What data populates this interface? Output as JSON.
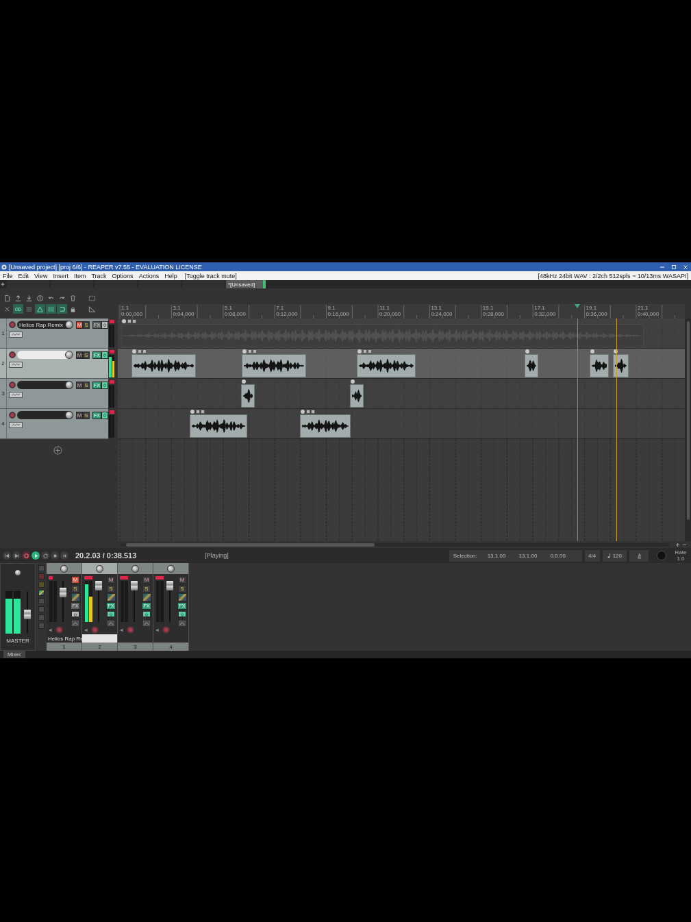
{
  "window": {
    "title": "[Unsaved project] [proj 6/6] - REAPER v7.55 - EVALUATION LICENSE"
  },
  "menu": {
    "items": [
      "File",
      "Edit",
      "View",
      "Insert",
      "Item",
      "Track",
      "Options",
      "Actions",
      "Help"
    ],
    "last_action": "[Toggle track mute]",
    "audio_status": "[48kHz 24bit WAV : 2/2ch 512spls ~ 10/13ms WASAPI]"
  },
  "project_tabs": [
    {
      "selected": false
    },
    {
      "selected": false
    },
    {
      "selected": false
    },
    {
      "selected": false
    },
    {
      "selected": false
    },
    {
      "label": "*[Unsaved]",
      "selected": true
    }
  ],
  "toolbar": {
    "rows": [
      [
        {
          "kind": "new",
          "on": false
        },
        {
          "kind": "import",
          "on": false
        },
        {
          "kind": "save",
          "on": false
        },
        {
          "kind": "count",
          "on": false
        },
        {
          "kind": "undo",
          "on": false
        },
        {
          "kind": "redo",
          "on": false
        },
        {
          "kind": "theme",
          "on": false
        },
        {
          "kind": "dock",
          "on": false
        }
      ],
      [
        {
          "kind": "cut",
          "on": false
        },
        {
          "kind": "link",
          "on": true
        },
        {
          "kind": "grid",
          "on": false
        },
        {
          "kind": "snap",
          "on": true
        },
        {
          "kind": "lines",
          "on": true
        },
        {
          "kind": "loop",
          "on": true
        },
        {
          "kind": "lock",
          "on": false
        },
        {
          "kind": "ruler",
          "on": false
        }
      ]
    ]
  },
  "ruler": {
    "marks": [
      {
        "bar": "1.1",
        "time": "0:00.000"
      },
      {
        "bar": "3.1",
        "time": "0:04.000"
      },
      {
        "bar": "5.1",
        "time": "0:08.000"
      },
      {
        "bar": "7.1",
        "time": "0:12.000"
      },
      {
        "bar": "9.1",
        "time": "0:16.000"
      },
      {
        "bar": "11.1",
        "time": "0:20.000"
      },
      {
        "bar": "13.1",
        "time": "0:24.000"
      },
      {
        "bar": "15.1",
        "time": "0:28.000"
      },
      {
        "bar": "17.1",
        "time": "0:32.000"
      },
      {
        "bar": "19.1",
        "time": "0:36.000"
      },
      {
        "bar": "21.1",
        "time": "0:40.000"
      }
    ]
  },
  "tracks": [
    {
      "number": "1",
      "name": "Helios Rap Remix",
      "selected": false,
      "muted": true,
      "fx_active": false,
      "clipped": true,
      "mute_label": "M",
      "solo_label": "S",
      "fx_label": "FX"
    },
    {
      "number": "2",
      "selected": true,
      "muted": false,
      "fx_active": true,
      "clipped": true,
      "meter": [
        {
          "level": 0.9
        },
        {
          "level": 0.72
        }
      ],
      "mute_label": "M",
      "solo_label": "S",
      "fx_label": "FX"
    },
    {
      "number": "3",
      "selected": false,
      "muted": false,
      "fx_active": true,
      "clipped": true,
      "mute_label": "M",
      "solo_label": "S",
      "fx_label": "FX"
    },
    {
      "number": "4",
      "selected": false,
      "muted": false,
      "fx_active": true,
      "clipped": true,
      "mute_label": "M",
      "solo_label": "S",
      "fx_label": "FX"
    }
  ],
  "transport": {
    "buttons": [
      {
        "kind": "start",
        "on": false
      },
      {
        "kind": "end",
        "on": false
      },
      {
        "kind": "record",
        "on": false
      },
      {
        "kind": "play",
        "on": true
      },
      {
        "kind": "repeat",
        "on": false
      },
      {
        "kind": "stop",
        "on": false
      },
      {
        "kind": "pause",
        "on": false
      }
    ],
    "position": "20.2.03 / 0:38.513",
    "status": "[Playing]",
    "selection": {
      "label": "Selection:",
      "start": "13.1.00",
      "end": "13.1.00",
      "length": "0.0.00"
    },
    "time_signature": "4/4",
    "tempo": "120",
    "rate": {
      "label": "Rate",
      "value": "1.0"
    }
  },
  "mixer": {
    "master": {
      "label": "MASTER",
      "meter": [
        {
          "level": 0.82
        },
        {
          "level": 0.82
        }
      ],
      "fader": {
        "level": 0.45
      }
    },
    "strips": [
      {
        "number": "1",
        "name": "Helios Rap Re",
        "selected": false,
        "muted": true,
        "fx_active": false,
        "fader": {
          "level": 0.72
        },
        "mute_label": "M",
        "solo_label": "S",
        "fx_label": "FX"
      },
      {
        "number": "2",
        "selected": true,
        "muted": false,
        "fx_active": true,
        "meter": [
          {
            "level": 0.92
          },
          {
            "level": 0.62
          }
        ],
        "fader": {
          "level": 0.88
        },
        "mute_label": "M",
        "solo_label": "S",
        "fx_label": "FX"
      },
      {
        "number": "3",
        "selected": false,
        "muted": false,
        "fx_active": true,
        "fader": {
          "level": 0.88
        },
        "mute_label": "M",
        "solo_label": "S",
        "fx_label": "FX"
      },
      {
        "number": "4",
        "selected": false,
        "muted": false,
        "fx_active": true,
        "fader": {
          "level": 0.88
        },
        "mute_label": "M",
        "solo_label": "S",
        "fx_label": "FX"
      }
    ],
    "dock_tab": "Mixer"
  }
}
